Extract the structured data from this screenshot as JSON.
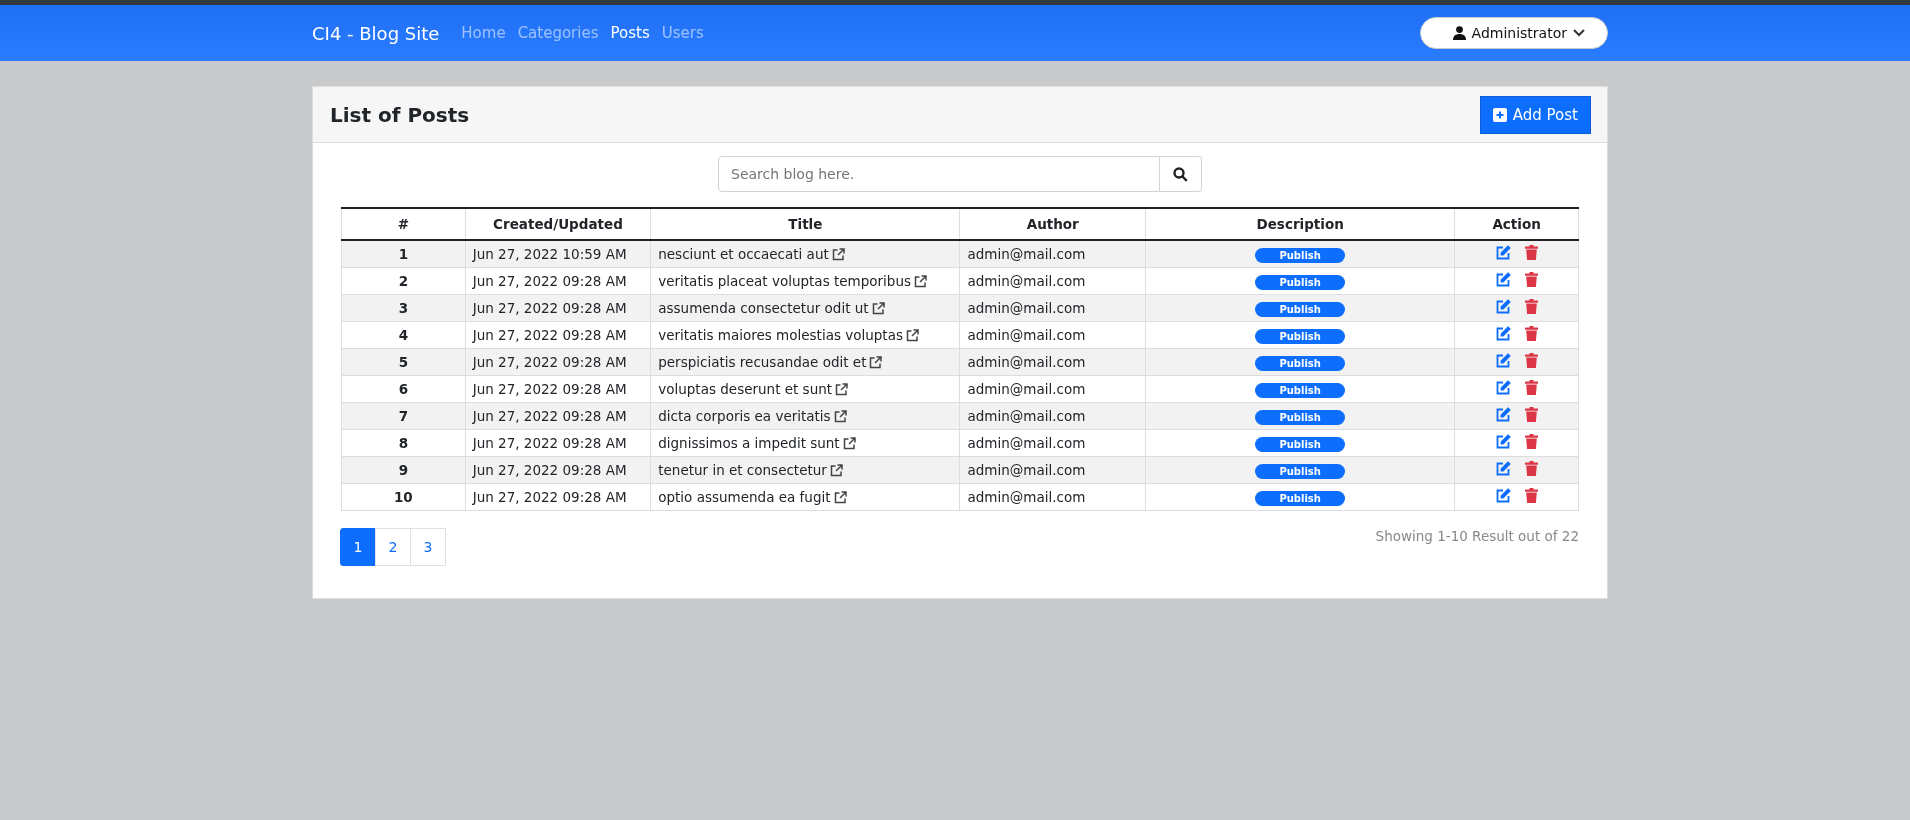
{
  "navbar": {
    "brand": "CI4 - Blog Site",
    "links": [
      {
        "label": "Home",
        "selected": false
      },
      {
        "label": "Categories",
        "selected": false
      },
      {
        "label": "Posts",
        "selected": true
      },
      {
        "label": "Users",
        "selected": false
      }
    ],
    "user_menu": "Administrator"
  },
  "card": {
    "title": "List of Posts",
    "add_button": "Add Post"
  },
  "search": {
    "placeholder": "Search blog here."
  },
  "table": {
    "columns": [
      "#",
      "Created/Updated",
      "Title",
      "Author",
      "Description",
      "Action"
    ],
    "rows": [
      {
        "number": "1",
        "date": "Jun 27, 2022 10:59 AM",
        "title": "nesciunt et occaecati aut",
        "author": "admin@mail.com",
        "status": "Publish"
      },
      {
        "number": "2",
        "date": "Jun 27, 2022 09:28 AM",
        "title": "veritatis placeat voluptas temporibus",
        "author": "admin@mail.com",
        "status": "Publish"
      },
      {
        "number": "3",
        "date": "Jun 27, 2022 09:28 AM",
        "title": "assumenda consectetur odit ut",
        "author": "admin@mail.com",
        "status": "Publish"
      },
      {
        "number": "4",
        "date": "Jun 27, 2022 09:28 AM",
        "title": "veritatis maiores molestias voluptas",
        "author": "admin@mail.com",
        "status": "Publish"
      },
      {
        "number": "5",
        "date": "Jun 27, 2022 09:28 AM",
        "title": "perspiciatis recusandae odit et",
        "author": "admin@mail.com",
        "status": "Publish"
      },
      {
        "number": "6",
        "date": "Jun 27, 2022 09:28 AM",
        "title": "voluptas deserunt et sunt",
        "author": "admin@mail.com",
        "status": "Publish"
      },
      {
        "number": "7",
        "date": "Jun 27, 2022 09:28 AM",
        "title": "dicta corporis ea veritatis",
        "author": "admin@mail.com",
        "status": "Publish"
      },
      {
        "number": "8",
        "date": "Jun 27, 2022 09:28 AM",
        "title": "dignissimos a impedit sunt",
        "author": "admin@mail.com",
        "status": "Publish"
      },
      {
        "number": "9",
        "date": "Jun 27, 2022 09:28 AM",
        "title": "tenetur in et consectetur",
        "author": "admin@mail.com",
        "status": "Publish"
      },
      {
        "number": "10",
        "date": "Jun 27, 2022 09:28 AM",
        "title": "optio assumenda ea fugit",
        "author": "admin@mail.com",
        "status": "Publish"
      }
    ]
  },
  "pagination": [
    {
      "label": "1",
      "selected": true
    },
    {
      "label": "2",
      "selected": false
    },
    {
      "label": "3",
      "selected": false
    }
  ],
  "result_summary": "Showing 1-10 Result out of 22"
}
